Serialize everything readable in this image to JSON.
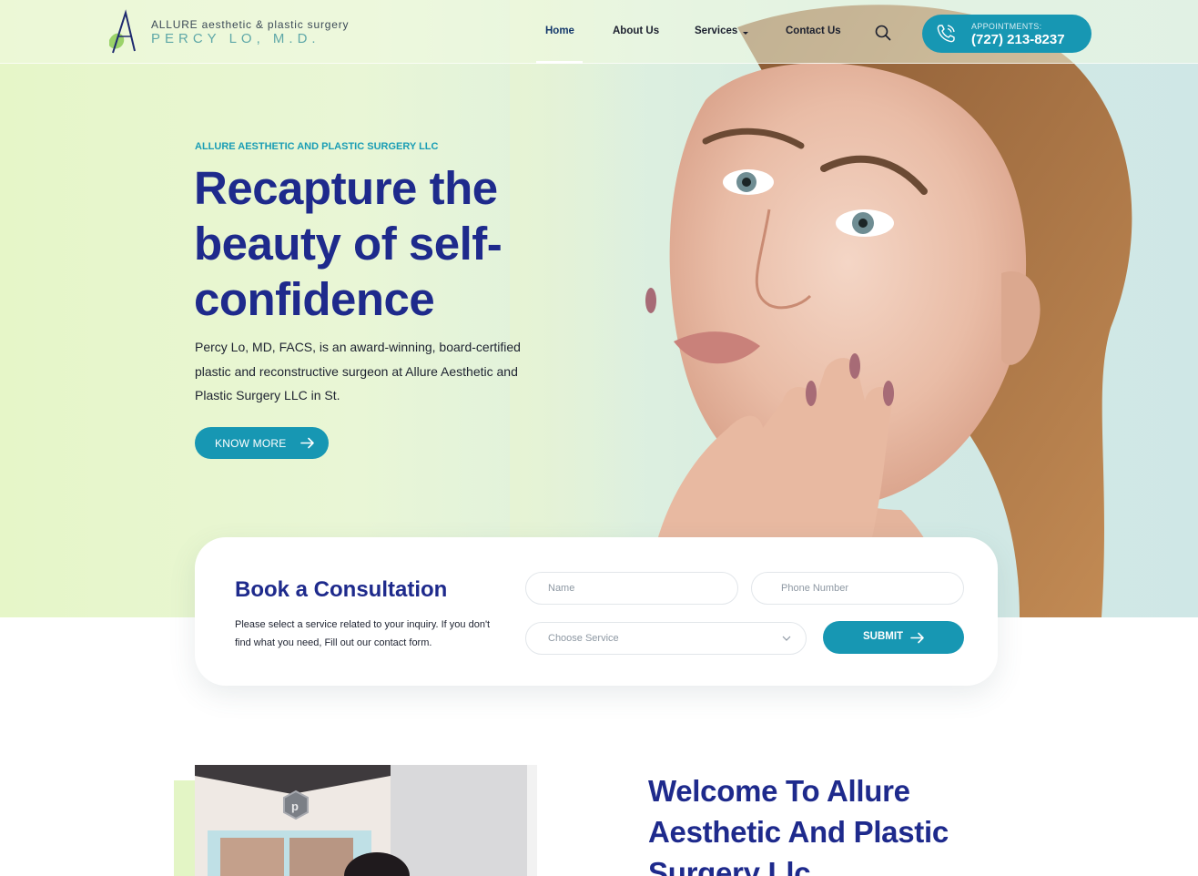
{
  "header": {
    "logo": {
      "line1": "ALLURE aesthetic & plastic surgery",
      "line2": "PERCY LO, M.D."
    },
    "nav": [
      {
        "label": "Home",
        "active": true
      },
      {
        "label": "About Us"
      },
      {
        "label": "Services",
        "has_dropdown": true
      },
      {
        "label": "Contact Us"
      }
    ],
    "search_icon": "search-icon",
    "appointments": {
      "label": "APPOINTMENTS:",
      "phone": "(727) 213-8237",
      "icon": "phone-icon"
    }
  },
  "hero": {
    "eyebrow": "ALLURE AESTHETIC AND PLASTIC SURGERY LLC",
    "headline": "Recapture the beauty of self-confidence",
    "description": "Percy Lo, MD, FACS, is an award-winning, board-certified plastic and reconstructive surgeon at Allure Aesthetic and Plastic Surgery LLC in St.",
    "cta": "KNOW MORE"
  },
  "consultation": {
    "title": "Book a Consultation",
    "text": "Please select a service related to your inquiry. If you don't find what you need, Fill out our contact form.",
    "name_placeholder": "Name",
    "phone_placeholder": "Phone Number",
    "service_placeholder": "Choose Service",
    "submit": "SUBMIT"
  },
  "welcome": {
    "title": "Welcome To Allure Aesthetic And Plastic Surgery Llc"
  },
  "colors": {
    "primary": "#1e2a8c",
    "accent": "#1797b3",
    "hero_bg": "#e6f6c8"
  }
}
